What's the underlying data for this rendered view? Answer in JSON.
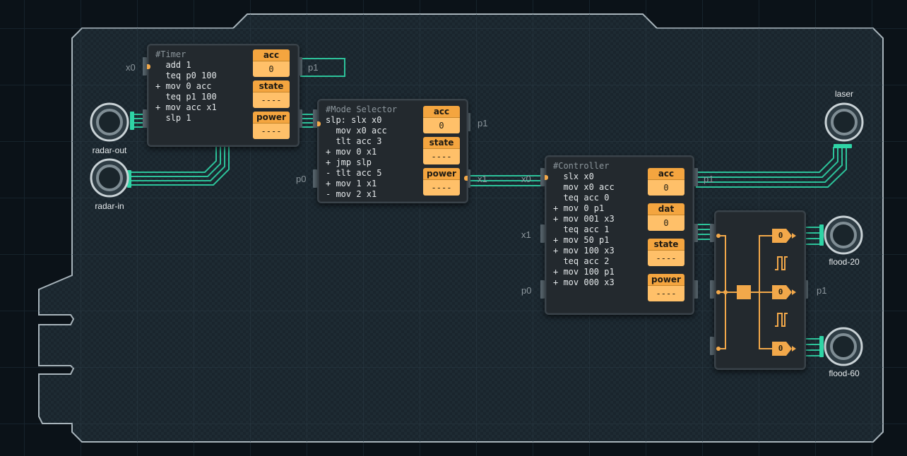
{
  "chips": {
    "timer": {
      "code": [
        "#Timer",
        "  add 1",
        "  teq p0 100",
        "+ mov 0 acc",
        "  teq p1 100",
        "+ mov acc x1",
        "  slp 1"
      ],
      "registers": [
        {
          "label": "acc",
          "value": "0"
        },
        {
          "label": "state",
          "value": "----"
        },
        {
          "label": "power",
          "value": "----"
        }
      ]
    },
    "mode_selector": {
      "code": [
        "#Mode Selector",
        "slp: slx x0",
        "  mov x0 acc",
        "  tlt acc 3",
        "+ mov 0 x1",
        "+ jmp slp",
        "- tlt acc 5",
        "+ mov 1 x1",
        "- mov 2 x1"
      ],
      "registers": [
        {
          "label": "acc",
          "value": "0"
        },
        {
          "label": "state",
          "value": "----"
        },
        {
          "label": "power",
          "value": "----"
        }
      ]
    },
    "controller": {
      "code": [
        "#Controller",
        "  slx x0",
        "  mov x0 acc",
        "  teq acc 0",
        "+ mov 0 p1",
        "+ mov 001 x3",
        "  teq acc 1",
        "+ mov 50 p1",
        "+ mov 100 x3",
        "  teq acc 2",
        "+ mov 100 p1",
        "+ mov 000 x3"
      ],
      "registers": [
        {
          "label": "acc",
          "value": "0"
        },
        {
          "label": "dat",
          "value": "0"
        },
        {
          "label": "state",
          "value": "----"
        },
        {
          "label": "power",
          "value": "----"
        }
      ]
    },
    "splitter": {
      "gate_values": [
        "0",
        "0",
        "0"
      ]
    }
  },
  "ports": {
    "timer_x0": "x0",
    "timer_p1": "p1",
    "mode_p1": "p1",
    "mode_p0": "p0",
    "mode_x1": "x1",
    "controller_x0": "x0",
    "controller_x1": "x1",
    "controller_p0": "p0",
    "controller_p1": "p1",
    "splitter_p1": "p1"
  },
  "devices": {
    "radar_out": "radar-out",
    "radar_in": "radar-in",
    "laser": "laser",
    "flood_20": "flood-20",
    "flood_60": "flood-60"
  },
  "colors": {
    "wire": "#2fd4a6",
    "register": "#ffc069",
    "register_label": "#f4a53f",
    "signal": "#f2a84a"
  }
}
